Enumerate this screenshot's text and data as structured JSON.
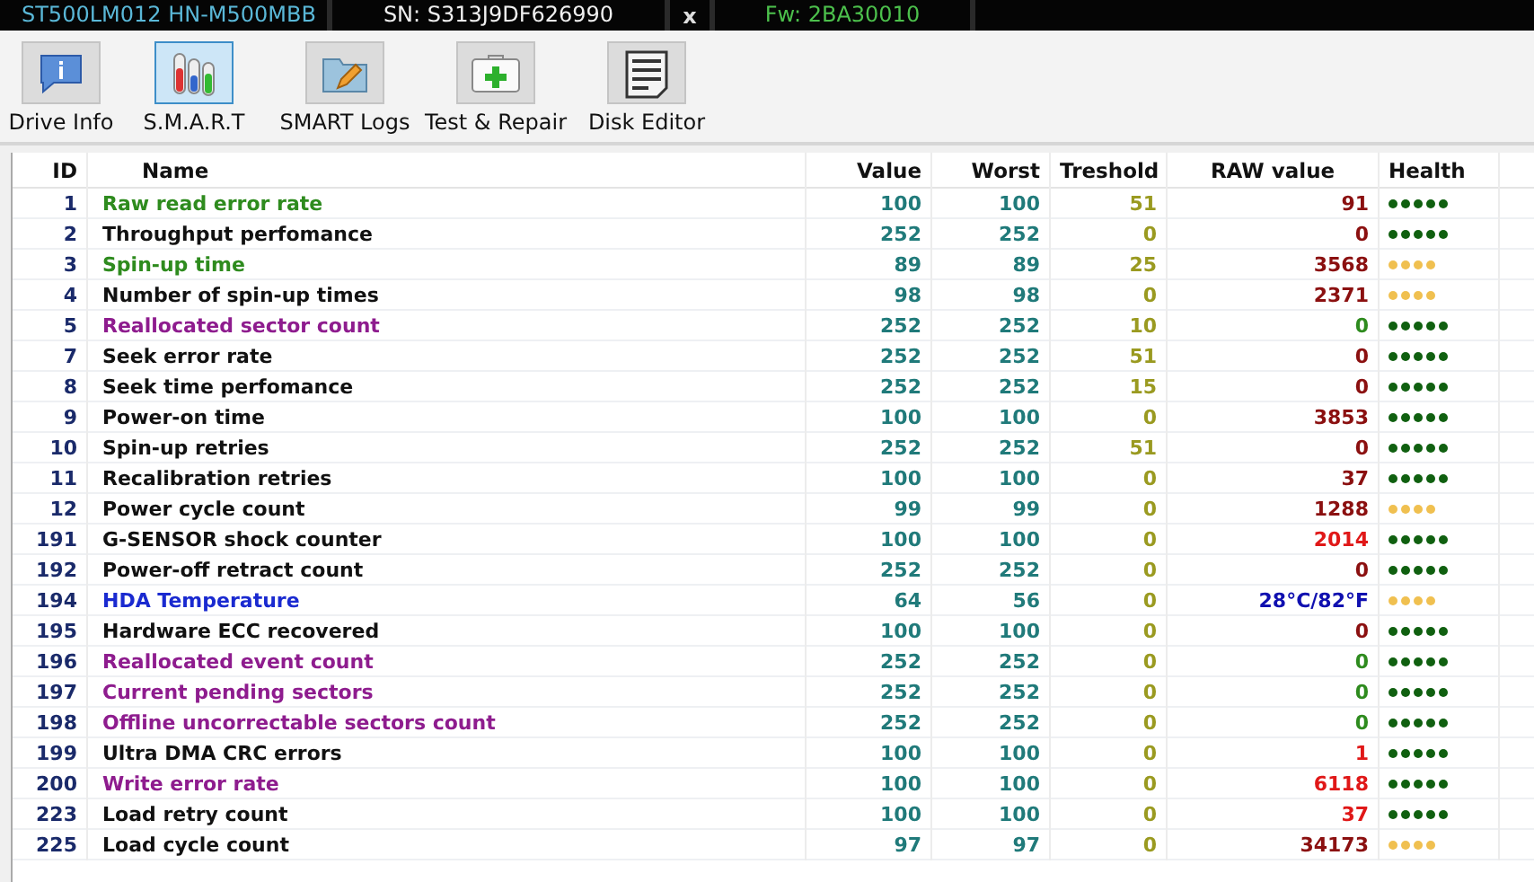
{
  "header": {
    "model": "ST500LM012 HN-M500MBB",
    "serial": "SN: S313J9DF626990",
    "close": "x",
    "firmware": "Fw: 2BA30010"
  },
  "toolbar": [
    {
      "label": "Drive Info",
      "kind": "info",
      "selected": false
    },
    {
      "label": "S.M.A.R.T",
      "kind": "tubes",
      "selected": true
    },
    {
      "label": "SMART Logs",
      "kind": "folder",
      "selected": false
    },
    {
      "label": "Test & Repair",
      "kind": "kit",
      "selected": false
    },
    {
      "label": "Disk Editor",
      "kind": "binary",
      "selected": false
    }
  ],
  "table": {
    "columns": [
      "ID",
      "Name",
      "Value",
      "Worst",
      "Treshold",
      "RAW value",
      "Health"
    ],
    "rows": [
      {
        "id": "1",
        "name": "Raw read error rate",
        "color": "#2e8b1e",
        "value": "100",
        "worst": "100",
        "threshold": "51",
        "raw": {
          "text": "91",
          "color": "#8b1010"
        },
        "stars": 5
      },
      {
        "id": "2",
        "name": "Throughput perfomance",
        "color": "#111111",
        "value": "252",
        "worst": "252",
        "threshold": "0",
        "raw": {
          "text": "0",
          "color": "#8b1010"
        },
        "stars": 5
      },
      {
        "id": "3",
        "name": "Spin-up time",
        "color": "#2e8b1e",
        "value": "89",
        "worst": "89",
        "threshold": "25",
        "raw": {
          "text": "3568",
          "color": "#8b1010"
        },
        "stars": 4
      },
      {
        "id": "4",
        "name": "Number of spin-up times",
        "color": "#111111",
        "value": "98",
        "worst": "98",
        "threshold": "0",
        "raw": {
          "text": "2371",
          "color": "#8b1010"
        },
        "stars": 4
      },
      {
        "id": "5",
        "name": "Reallocated sector count",
        "color": "#8e1c8e",
        "value": "252",
        "worst": "252",
        "threshold": "10",
        "raw": {
          "text": "0",
          "color": "#2e8b1e"
        },
        "stars": 5
      },
      {
        "id": "7",
        "name": "Seek error rate",
        "color": "#111111",
        "value": "252",
        "worst": "252",
        "threshold": "51",
        "raw": {
          "text": "0",
          "color": "#8b1010"
        },
        "stars": 5
      },
      {
        "id": "8",
        "name": "Seek time perfomance",
        "color": "#111111",
        "value": "252",
        "worst": "252",
        "threshold": "15",
        "raw": {
          "text": "0",
          "color": "#8b1010"
        },
        "stars": 5
      },
      {
        "id": "9",
        "name": "Power-on time",
        "color": "#111111",
        "value": "100",
        "worst": "100",
        "threshold": "0",
        "raw": {
          "text": "3853",
          "color": "#8b1010"
        },
        "stars": 5
      },
      {
        "id": "10",
        "name": "Spin-up retries",
        "color": "#111111",
        "value": "252",
        "worst": "252",
        "threshold": "51",
        "raw": {
          "text": "0",
          "color": "#8b1010"
        },
        "stars": 5
      },
      {
        "id": "11",
        "name": "Recalibration retries",
        "color": "#111111",
        "value": "100",
        "worst": "100",
        "threshold": "0",
        "raw": {
          "text": "37",
          "color": "#8b1010"
        },
        "stars": 5
      },
      {
        "id": "12",
        "name": "Power cycle count",
        "color": "#111111",
        "value": "99",
        "worst": "99",
        "threshold": "0",
        "raw": {
          "text": "1288",
          "color": "#8b1010"
        },
        "stars": 4
      },
      {
        "id": "191",
        "name": "G-SENSOR shock counter",
        "color": "#111111",
        "value": "100",
        "worst": "100",
        "threshold": "0",
        "raw": {
          "text": "2014",
          "color": "#e01818"
        },
        "stars": 5
      },
      {
        "id": "192",
        "name": "Power-off retract count",
        "color": "#111111",
        "value": "252",
        "worst": "252",
        "threshold": "0",
        "raw": {
          "text": "0",
          "color": "#8b1010"
        },
        "stars": 5
      },
      {
        "id": "194",
        "name": "HDA Temperature",
        "color": "#1a2ad0",
        "value": "64",
        "worst": "56",
        "threshold": "0",
        "raw": {
          "text": "28°C/82°F",
          "color": "#1010b0"
        },
        "stars": 4
      },
      {
        "id": "195",
        "name": "Hardware ECC recovered",
        "color": "#111111",
        "value": "100",
        "worst": "100",
        "threshold": "0",
        "raw": {
          "text": "0",
          "color": "#8b1010"
        },
        "stars": 5
      },
      {
        "id": "196",
        "name": "Reallocated event count",
        "color": "#8e1c8e",
        "value": "252",
        "worst": "252",
        "threshold": "0",
        "raw": {
          "text": "0",
          "color": "#2e8b1e"
        },
        "stars": 5
      },
      {
        "id": "197",
        "name": "Current pending sectors",
        "color": "#8e1c8e",
        "value": "252",
        "worst": "252",
        "threshold": "0",
        "raw": {
          "text": "0",
          "color": "#2e8b1e"
        },
        "stars": 5
      },
      {
        "id": "198",
        "name": "Offline uncorrectable sectors count",
        "color": "#8e1c8e",
        "value": "252",
        "worst": "252",
        "threshold": "0",
        "raw": {
          "text": "0",
          "color": "#2e8b1e"
        },
        "stars": 5
      },
      {
        "id": "199",
        "name": "Ultra DMA CRC errors",
        "color": "#111111",
        "value": "100",
        "worst": "100",
        "threshold": "0",
        "raw": {
          "text": "1",
          "color": "#e01818"
        },
        "stars": 5
      },
      {
        "id": "200",
        "name": "Write error rate",
        "color": "#8e1c8e",
        "value": "100",
        "worst": "100",
        "threshold": "0",
        "raw": {
          "text": "6118",
          "color": "#e01818"
        },
        "stars": 5
      },
      {
        "id": "223",
        "name": "Load retry count",
        "color": "#111111",
        "value": "100",
        "worst": "100",
        "threshold": "0",
        "raw": {
          "text": "37",
          "color": "#e01818"
        },
        "stars": 5
      },
      {
        "id": "225",
        "name": "Load cycle count",
        "color": "#111111",
        "value": "97",
        "worst": "97",
        "threshold": "0",
        "raw": {
          "text": "34173",
          "color": "#8b1010"
        },
        "stars": 4
      }
    ]
  }
}
